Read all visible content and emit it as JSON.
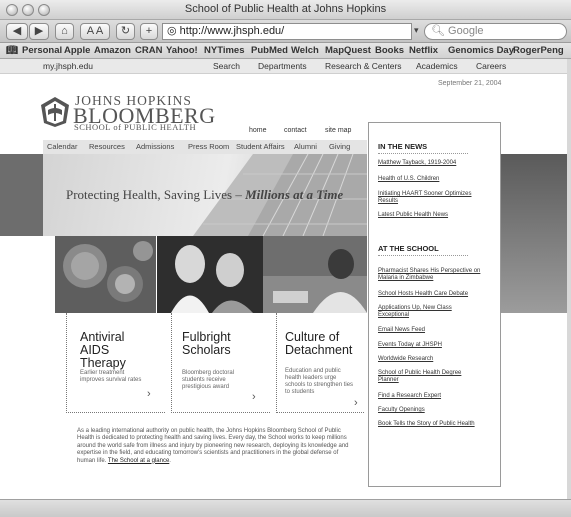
{
  "window": {
    "title": "School of Public Health at Johns Hopkins"
  },
  "toolbar": {
    "back_icon": "back-arrow-icon",
    "forward_icon": "forward-arrow-icon",
    "home_icon": "home-icon",
    "text_size": "A A",
    "reload_icon": "reload-icon",
    "add_icon": "plus-icon",
    "address": "http://www.jhsph.edu/",
    "search_placeholder": "Google"
  },
  "bookmarks": [
    "Personal",
    "Apple",
    "Amazon",
    "CRAN",
    "Yahoo!",
    "NYTimes",
    "PubMed",
    "Welch",
    "MapQuest",
    "Books",
    "Netflix",
    "Genomics Day",
    "RogerPeng"
  ],
  "topnav": {
    "portal": "my.jhsph.edu",
    "items": [
      "Search",
      "Departments",
      "Research & Centers",
      "Academics",
      "Careers"
    ]
  },
  "date": "September 21, 2004",
  "logo": {
    "line1": "JOHNS HOPKINS",
    "line2": "BLOOMBERG",
    "line3": "SCHOOL of PUBLIC HEALTH"
  },
  "site_links": [
    "home",
    "contact",
    "site map"
  ],
  "section_nav": [
    "Calendar",
    "Resources",
    "Admissions",
    "Press Room",
    "Student Affairs",
    "Alumni",
    "Giving"
  ],
  "hero": {
    "text": "Protecting Health, Saving Lives – ",
    "emphasis": "Millions at a Time"
  },
  "features": [
    {
      "title": [
        "Antiviral",
        "AIDS",
        "Therapy"
      ],
      "desc": [
        "Earlier treatment",
        "improves survival rates"
      ]
    },
    {
      "title": [
        "Fulbright",
        "Scholars"
      ],
      "desc": [
        "Bloomberg doctoral",
        "students receive",
        "prestigious award"
      ]
    },
    {
      "title": [
        "Culture of",
        "Detachment"
      ],
      "desc": [
        "Education and public",
        "health leaders urge",
        "schools to strengthen ties",
        "to students"
      ]
    }
  ],
  "about": {
    "text": "As a leading international authority on public health, the Johns Hopkins Bloomberg School of Public Health is dedicated to protecting health and saving lives. Every day, the School works to keep millions around the world safe from illness and injury by pioneering new research, deploying its knowledge and expertise in the field, and educating tomorrow's scientists and practitioners in the global defense of human life.",
    "link": "The School at a glance"
  },
  "news": {
    "heading": "IN THE NEWS",
    "items": [
      "Matthew Tayback, 1919-2004",
      "Health of U.S. Children",
      "Initiating HAART Sooner Optimizes Results",
      "Latest Public Health News"
    ]
  },
  "school": {
    "heading": "AT THE SCHOOL",
    "items": [
      "Pharmacist Shares His Perspective on Malaria in Zimbabwe",
      "School Hosts Health Care Debate",
      "Applications Up, New Class Exceptional",
      "Email News Feed",
      "Events Today at JHSPH",
      "Worldwide Research",
      "School of Public Health Degree Planner",
      "Find a Research Expert",
      "Faculty Openings",
      "Book Tells the Story of Public Health"
    ]
  },
  "colors": {
    "hero_band": "#6d6d6d",
    "chrome": "#d4d4d4"
  }
}
